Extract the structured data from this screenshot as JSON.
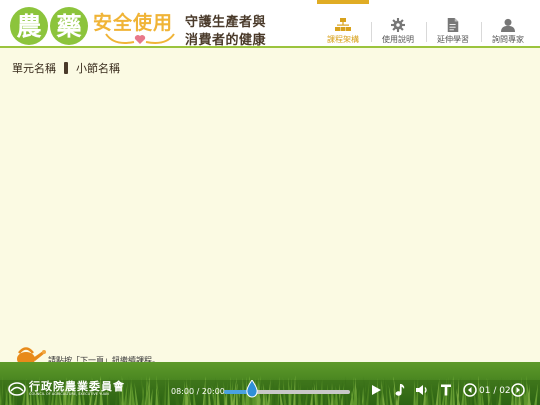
{
  "header": {
    "logo_char_1": "農",
    "logo_char_2": "藥",
    "logo_subtitle": "安全使用",
    "slogan_line_1": "守護生產者與",
    "slogan_line_2": "消費者的健康"
  },
  "nav": {
    "items": [
      {
        "label": "課程架構",
        "icon": "sitemap-icon",
        "active": true
      },
      {
        "label": "使用說明",
        "icon": "gear-icon",
        "active": false
      },
      {
        "label": "延伸學習",
        "icon": "document-icon",
        "active": false
      },
      {
        "label": "詢問專家",
        "icon": "user-icon",
        "active": false
      }
    ]
  },
  "breadcrumb": {
    "unit_name": "單元名稱",
    "section_name": "小節名稱"
  },
  "hint": {
    "text": "請點按「下一頁」鈕繼續課程。",
    "icon": "watering-can-icon"
  },
  "footer": {
    "org_name_cn": "行政院農業委員會",
    "org_name_en": "COUNCIL OF AGRICULTURE, EXECUTIVE YUAN",
    "time": "08:00 / 20:00",
    "progress": 0.4,
    "page_indicator": "01 / 02"
  },
  "colors": {
    "accent_green": "#8cc43c",
    "accent_gold": "#e0ac24",
    "content_bg": "#fbfae3",
    "progress_blue": "#4aa2e0"
  }
}
